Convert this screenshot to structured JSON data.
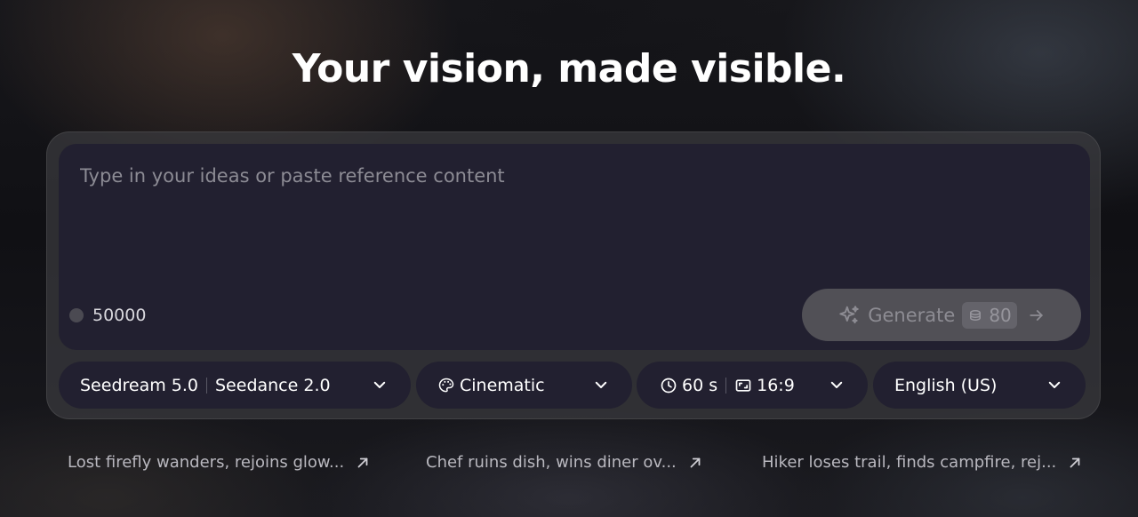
{
  "headline": "Your vision, made visible.",
  "prompt": {
    "placeholder": "Type in your ideas or paste reference content",
    "value": ""
  },
  "credits": {
    "value": "50000",
    "icon": "coin-dot-icon"
  },
  "generate": {
    "label": "Generate",
    "cost": "80",
    "icons": [
      "sparkle-icon",
      "coin-stack-icon",
      "arrow-right-icon"
    ]
  },
  "options": {
    "image_model": "Seedream 5.0",
    "video_model": "Seedance 2.0",
    "style": "Cinematic",
    "duration": "60 s",
    "aspect_ratio": "16:9",
    "language": "English (US)"
  },
  "suggestions": [
    {
      "text": "Lost firefly wanders, rejoins glow..."
    },
    {
      "text": "Chef ruins dish, wins diner ov..."
    },
    {
      "text": "Hiker loses trail, finds campfire, rej..."
    }
  ],
  "colors": {
    "page_bg": "#121215",
    "panel_bg": "#3a3a3e",
    "input_bg": "#222030",
    "generate_bg": "#515056",
    "muted_text": "#8c8b94"
  }
}
